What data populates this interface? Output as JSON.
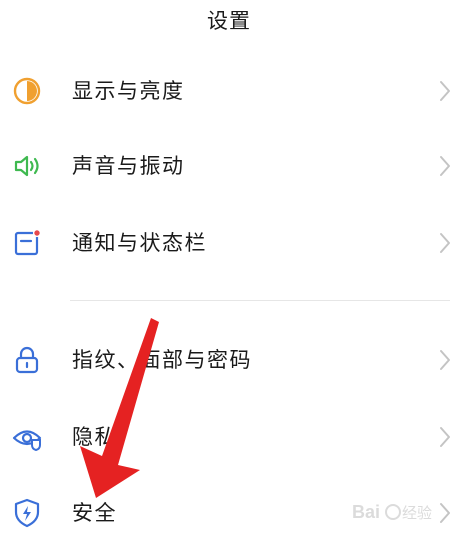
{
  "header": {
    "title": "设置"
  },
  "settings": {
    "items": [
      {
        "id": "display",
        "label": "显示与亮度",
        "icon": "brightness-icon",
        "color": "#f0a030"
      },
      {
        "id": "sound",
        "label": "声音与振动",
        "icon": "speaker-icon",
        "color": "#3fb950"
      },
      {
        "id": "notify",
        "label": "通知与状态栏",
        "icon": "notification-icon",
        "color": "#3a6fd8"
      },
      {
        "id": "fingerprint",
        "label": "指纹、面部与密码",
        "icon": "lock-icon",
        "color": "#3a6fd8"
      },
      {
        "id": "privacy",
        "label": "隐私",
        "icon": "eye-shield-icon",
        "color": "#3a6fd8"
      },
      {
        "id": "security",
        "label": "安全",
        "icon": "security-shield-icon",
        "color": "#3a6fd8"
      }
    ]
  },
  "overlay": {
    "arrow_color": "#e52222"
  },
  "watermark": {
    "text": "Baidu经验"
  }
}
